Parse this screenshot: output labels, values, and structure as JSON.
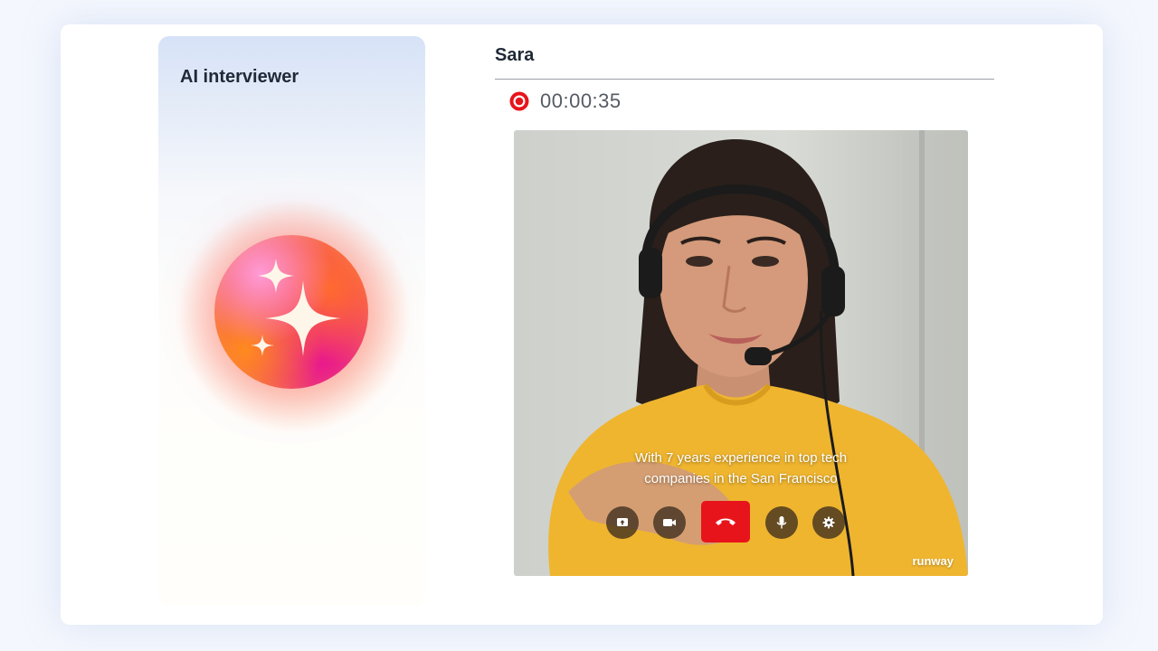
{
  "left_panel": {
    "title": "AI interviewer",
    "icon": "sparkle-icon"
  },
  "call": {
    "name": "Sara",
    "recording_icon": "record-icon",
    "timer": "00:00:35",
    "caption": {
      "line1": "With 7 years experience in top tech",
      "line2": "companies in the San Francisco"
    },
    "controls": [
      {
        "name": "share-screen-button",
        "icon": "share-screen-icon"
      },
      {
        "name": "camera-button",
        "icon": "video-camera-icon"
      },
      {
        "name": "end-call-button",
        "icon": "phone-hangup-icon"
      },
      {
        "name": "microphone-button",
        "icon": "microphone-icon"
      },
      {
        "name": "settings-button",
        "icon": "gear-icon"
      }
    ],
    "watermark": "runway"
  },
  "colors": {
    "accent_red": "#e8141b",
    "text_dark": "#1f2937",
    "timer_gray": "#555b63"
  }
}
